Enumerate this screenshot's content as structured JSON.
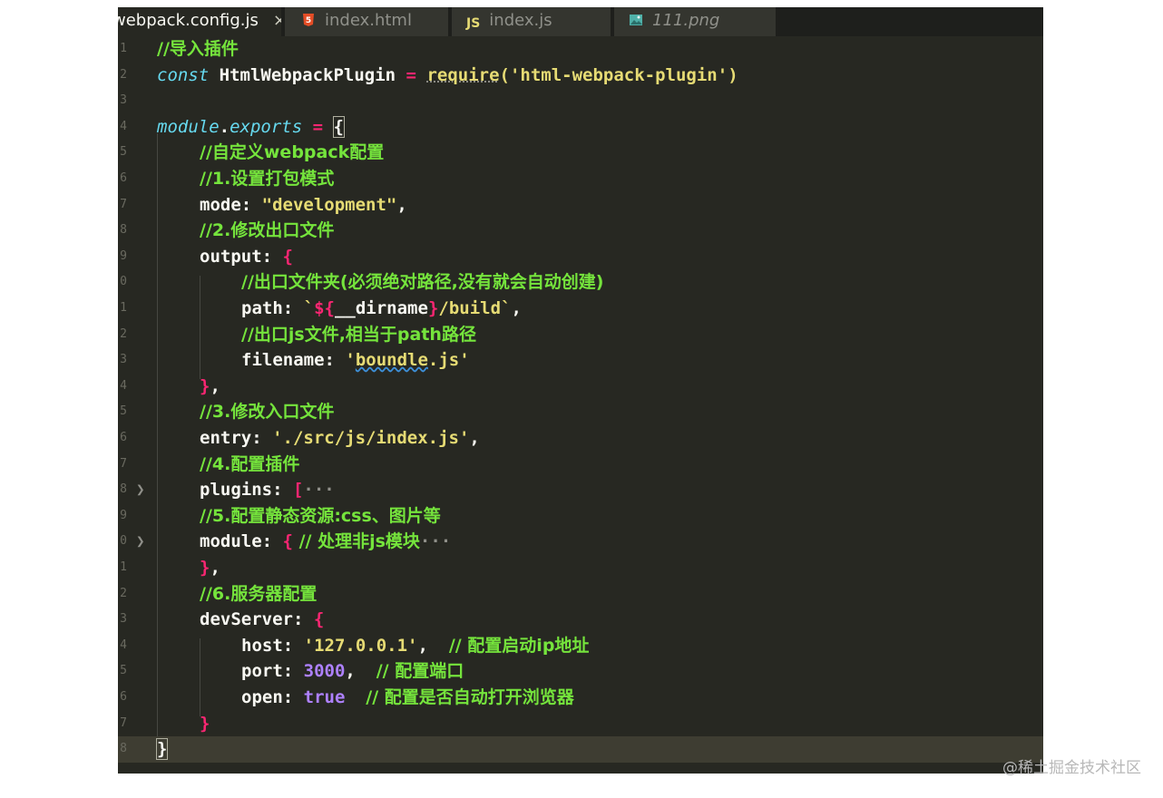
{
  "tabs": [
    {
      "label": "webpack.config.js",
      "icon": "js-file-icon",
      "active": true
    },
    {
      "label": "index.html",
      "icon": "html5-file-icon",
      "active": false
    },
    {
      "label": "index.js",
      "icon": "js-file-icon",
      "active": false
    },
    {
      "label": "111.png",
      "icon": "image-file-icon",
      "active": false
    }
  ],
  "tab_close": "×",
  "gutter_numbers": [
    "1",
    "2",
    "3",
    "4",
    "5",
    "6",
    "7",
    "8",
    "9",
    "0",
    "1",
    "2",
    "3",
    "4",
    "5",
    "6",
    "7",
    "8",
    "9",
    "0",
    "1",
    "2",
    "3",
    "4",
    "5",
    "6",
    "7",
    "8"
  ],
  "code": {
    "l1_comment": "//导入插件",
    "l2_const": "const",
    "l2_name": " HtmlWebpackPlugin ",
    "l2_eq": "=",
    "l2_require": "require",
    "l2_arg": "('html-webpack-plugin')",
    "l4_module": "module",
    "l4_dot": ".",
    "l4_exports": "exports",
    "l4_eq": " = ",
    "l4_brace": "{",
    "l5_comment": "//自定义webpack配置",
    "l6_comment": "//1.设置打包模式",
    "l7_key": "mode: ",
    "l7_val": "\"development\"",
    "l7_comma": ",",
    "l8_comment": "//2.修改出口文件",
    "l9_key": "output: ",
    "l9_brace": "{",
    "l10_comment": "//出口文件夹(必须绝对路径,没有就会自动创建)",
    "l11_key": "path: ",
    "l11_tick": "`",
    "l11_dollar": "${",
    "l11_var": "__dirname",
    "l11_close": "}",
    "l11_rest": "/build`",
    "l11_comma": ",",
    "l12_comment": "//出口js文件,相当于path路径",
    "l13_key": "filename: ",
    "l13_q1": "'",
    "l13_word": "boundle",
    "l13_rest": ".js'",
    "l14_brace": "}",
    "l14_comma": ",",
    "l15_comment": "//3.修改入口文件",
    "l16_key": "entry: ",
    "l16_val": "'./src/js/index.js'",
    "l16_comma": ",",
    "l17_comment": "//4.配置插件",
    "l18_key": "plugins: ",
    "l18_bracket": "[",
    "l18_ellipsis": "···",
    "l19_comment": "//5.配置静态资源:css、图片等",
    "l20_key": "module: ",
    "l20_brace": "{",
    "l20_comment": " // 处理非js模块",
    "l20_ellipsis": "···",
    "l21_brace": "}",
    "l21_comma": ",",
    "l22_comment": "//6.服务器配置",
    "l23_key": "devServer: ",
    "l23_brace": "{",
    "l24_key": "host: ",
    "l24_val": "'127.0.0.1'",
    "l24_comma": ",  ",
    "l24_comment": "// 配置启动ip地址",
    "l25_key": "port: ",
    "l25_val": "3000",
    "l25_comma": ",  ",
    "l25_comment": "// 配置端口",
    "l26_key": "open: ",
    "l26_val": "true",
    "l26_sp": "  ",
    "l26_comment": "// 配置是否自动打开浏览器",
    "l27_brace": "}",
    "l28_brace": "}"
  },
  "watermark": "@稀土掘金技术社区",
  "colors": {
    "editor_bg": "#272822",
    "comment": "#75e43c",
    "keyword": "#66d9ef",
    "string": "#e6db74",
    "number": "#ae81ff",
    "operator": "#f92672"
  }
}
